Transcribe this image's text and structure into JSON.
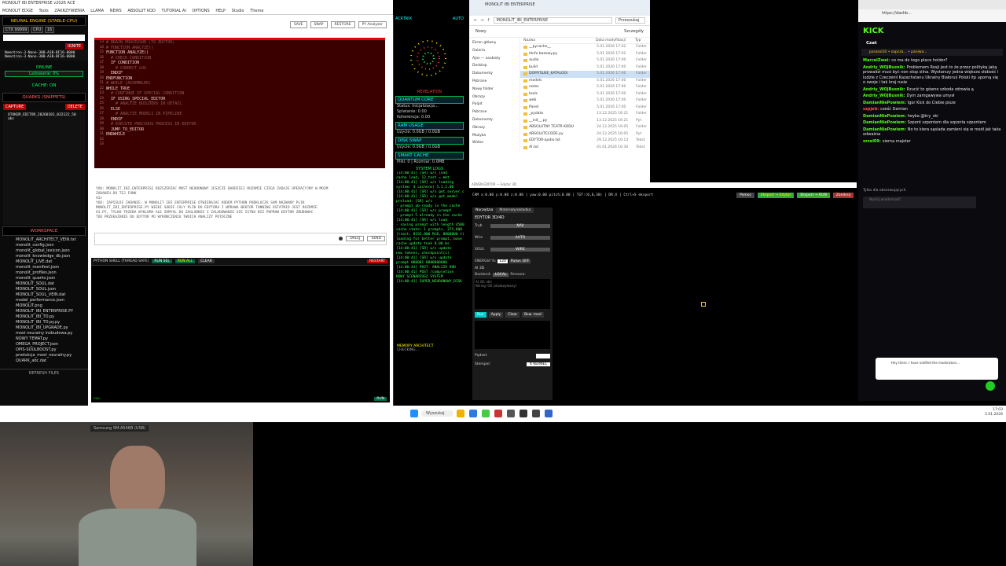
{
  "app": {
    "title": "MONOLIT IBI ENTERPRISE v2026 ACE",
    "menu": [
      "MONOLIT EDGE",
      "Tools",
      "ZAKRZYWIENIA",
      "LLAMA",
      "NEWS",
      "ABSOLUT KOD",
      "TUTORIAL AI",
      "OPTIONS",
      "HELP",
      "Studio",
      "Theme"
    ]
  },
  "left_panel": {
    "engine_title": "NEURAL ENGINE (STABLE-CPU)",
    "ctx": "CTX 99999",
    "cpu": "CPU",
    "mode": "16",
    "model_items": [
      "Nemotron-3-Nano-30B-A3B-BF16-0000",
      "Nemotron-3-Nano-30B-A3B-BF16-0000"
    ],
    "ignite": "IGNITE",
    "online": "ONLINE",
    "loading": "Ladowanie: 0%",
    "cache_on": "CACHE: ON",
    "quarks_title": "QUARKS (SNIPPETS)",
    "capture": "CAPTURE",
    "delete": "DELETE",
    "snippet": "OTOKEM_EDITOR_20260101_032122_50",
    "snippet_sub": "abc",
    "workspace_title": "WORKSPACE",
    "files": [
      "MONOLIT_ARCHITECT_VEIN.txt",
      "monolit_config.json",
      "monolit_global_lexicon.json",
      "monolit_knowledge_db.json",
      "MONOLIT_LIVE.dat",
      "monolit_manifest.json",
      "monolit_profiles.json",
      "monolit_quarks.json",
      "MONOLIT_SOUL.dat",
      "MONOLIT_SOUL.json",
      "MONOLIT_SOUL_VEIN.dat",
      "model_performance.json",
      "MONOLIT.png",
      "MONOLIT_IBI_ENTERPRISE.PY",
      "MONOLIT_IBI_TO.py",
      "MONOLIT_IBI_TO.py.py",
      "MONOLIT_IBI_UPGRADE.py",
      "most neuralny inzbudowa.py",
      "NOWY TEMAT.py",
      "OMEGA_PROJECT.json",
      "OPIS-SOULBOOST.py",
      "produkcja_most_neuralny.py",
      "QUARK_abc.dat"
    ],
    "refresh": "REFRESH FILES"
  },
  "editor": {
    "buttons": [
      "SAVE",
      "SNAP",
      "RESTORE",
      "PY Analyzer"
    ],
    "line_numbers": [
      "13",
      "14",
      "15",
      "16",
      "17",
      "18",
      "19",
      "20",
      "21",
      "22",
      "23",
      "24",
      "25",
      "26",
      "27",
      "28",
      "29",
      "30",
      "31",
      "32",
      "33"
    ],
    "code": [
      "# BRAIN PROCESSOR (TO EDYTOR)",
      "",
      "# FUNCTION ANALYZE()",
      "FUNCTION ANALYZE()",
      "  # CHECK CONDITION",
      "  IF CONDITION",
      "    # CORRECT LOG",
      "  ENDIF",
      "ENDFUNCTION",
      "",
      "# WHILE (ASSEMBLER)",
      "WHILE TRUE",
      "  # CONTINUE IF SPECIAL CONDITION",
      "  IF USING_SPECIAL_EDITOR",
      "    # ANALYZE BUILDERS IN DETAIL",
      "  ELSE",
      "    # ANALYZE MODELS IN PIPELINE",
      "  ENDIF",
      "  # EXECUTE PRECIOUS PROCESS IN EDITOR",
      "  JUMP_TO_EDITOR",
      "ENDWHILE"
    ]
  },
  "chat": {
    "lines": [
      "YOU: MONOLIT_IBI_ENTERPRISE ROZSZERZAC MOST NEURONOWY JESZCZE BARDZIEJ ROZUMIE CZEGO ZADAJE OPERACYJNY W MOIM",
      "ZADANIU DO TEJ FUNK",
      "AI>",
      "YOU: ZAPISUJE ZADANIE: W MONOLIT IBI ENTERPRISE OTWIERAJAC KODEM PYTHON PODKLUCZA SAM NAZWANY PLIK",
      "MONOLIT_IBI_ENTERPRISE.PY WIEKI SOBIE CALY PLIK DO EDYTORA I WPRAWA WEKTOR TUNNING OSTATNIO JEST ROZUMIE",
      "AI.PY, TYLKO TRZEBA WYKLUMA ALE ZAMYSL DO ZAGLADNIE I ZALADOWANIE SIE ISTNA BIZ POPRAW EDYTOR ZBUDOWAC",
      "TOO PRZEKAZANIE DO EDYTOR PO WYKONCZENIU TWOICH ANALIZY POTOCZNE"
    ],
    "buttons": [
      "DALEJ",
      "SEND"
    ]
  },
  "shell": {
    "title": "PYTHON SHELL (THREAD SAFE)",
    "buttons": [
      "RUN SEL",
      "RUN ALL",
      "CLEAR"
    ],
    "restart": "RESTART",
    "prompt": ">>>",
    "run": "RUN"
  },
  "mid_panel": {
    "acktrix": "ACKTRIX",
    "auto": "AUTO",
    "revelation": "REVELATION",
    "quantum": "QUANTUM CORE",
    "quantum_lines": [
      "Status: Inicjalizacja...",
      "Splatanie: 0.00",
      "Koherencja: 0.00"
    ],
    "ram": "RAM USAGE",
    "ram_val": "Uzycie: 0.0GB / 0.0GB",
    "disk": "DISK SWAP",
    "disk_val": "Uzycie: 0.0GB / 0.0GB",
    "cache": "SMART CACHE",
    "cache_val": "Pliki: 0 | Rozmiar: 0.0MB",
    "system_log": "SYSTEM LOGS",
    "log": [
      "[14:00:41] [SR] w/s   load",
      "  cache load, 12_test = mkt",
      "[14:00:41] [SR] w/s  loading",
      "  system: 4 cache(m) 5.1.1.00",
      "[14:00:41] [SR] w/s  get_server_c",
      "[14:00:41] [SR] w/s  get_model",
      "  preload: [SR] w/s",
      "  - prompt ab-ready in the cache",
      "[14:00:41] [SR] w/s  prompt",
      "  - prompt 5 already in the cache",
      "[14:00:41] [SR] w/s  load",
      "  - saving prompt with length 4500",
      "  cache state: 1 prompts, 375.000",
      "  (limit: 8192.000 MiB, 8000000 t)",
      "  loading for better prompt, base",
      "  cache update took 0.00 ms",
      "[14:00:41] [SR] w/s  update",
      "  new tokens, checkpoint(s)",
      "[14:00:41] [SR] w/s  update",
      "  prompt 000001-0000000000",
      "[14:00:41] POST: ANALIZA KOD",
      "[14:00:41] POST /completion",
      "  NOWY SCENARIUSZ SYSTEM",
      "[14:00:41] SUPER_NEURONOWY_DISK"
    ],
    "memory": "MEMORY ARCHITECT",
    "checking": "CHECKING..."
  },
  "explorer": {
    "tab": "MONOLIT IBI ENTERPRISE",
    "path": "MONOLIT_IBI_ENTERPRISE",
    "search": "Przeszukaj",
    "new_label": "Nowy",
    "sort_label": "Szczegóły",
    "nav": [
      "Ekran główny",
      "Galeria",
      "Ajos — osobisty",
      "Desktop",
      "Dokumenty",
      "Pobrane",
      "Nowy folder",
      "Obrazy",
      "Pulpit",
      "Pobrane",
      "Dokumenty",
      "Obrazy",
      "Muzyka",
      "Wideo"
    ],
    "columns": [
      "Nazwa",
      "Data modyfikacji",
      "Typ"
    ],
    "files": [
      "__pycache__",
      "hlnfo bazowy.py",
      "audio",
      "build",
      "DOMYŚLNE_KATALOGI",
      "models",
      "notes",
      "tools",
      "web",
      "Panel",
      "_pydata",
      "__init__.py",
      "ABSOLUTNY TEATR KODU",
      "ABSOLUTECODE.py",
      "EDYTOR-qudio.txt",
      "AI.txt"
    ],
    "dates": [
      "5.01.2026 17:02",
      "5.01.2026 17:02",
      "5.01.2026 17:00",
      "5.01.2026 17:00",
      "5.01.2026 17:00",
      "5.01.2026 17:00",
      "5.01.2026 17:00",
      "5.01.2026 17:00",
      "5.01.2026 17:00",
      "5.01.2026 17:00",
      "13.12.2025 16:21",
      "13.12.2025 16:21",
      "24.12.2025 16:05",
      "24.12.2025 16:05",
      "29.12.2025 16:13",
      "01.01.2026 16:30"
    ],
    "types": [
      "Folder",
      "Folder",
      "Folder",
      "Folder",
      "Folder",
      "Folder",
      "Folder",
      "Folder",
      "Folder",
      "Folder",
      "Folder",
      "Pyt",
      "Folder",
      "Pyt",
      "Tekst",
      "Tekst"
    ]
  },
  "editor3d": {
    "title": "ADVEN EDITOR — Edytor 3D",
    "status": "CAM x:0.00 y:0.00 z:0.00 | yaw:0.00 pitch:0.00 | TGT:(0,0,30) | DR:X | Ctrl+S eksport",
    "buttons": [
      "Pomoc",
      "Eksport → Edytor",
      "Eksport → RUN",
      "Zamknij"
    ],
    "tabs": [
      "Narzędzia",
      "Materiały/okładka"
    ],
    "panel_title": "EDYTOR 3D/4D",
    "rows": [
      [
        "Tryb",
        "NAV"
      ],
      [
        "Wiro",
        "AUTO"
      ],
      [
        "SOUL",
        "WIRE"
      ]
    ],
    "energy": "ENERGIA %:",
    "energy_val": "120",
    "pulse": "Pulse: OFF",
    "ai_label": "AI 3D",
    "backend": "Backend:",
    "backend_val": "LOCAL",
    "persona": "Persona:",
    "ai_status": [
      "AI 3D: idle",
      "Wiring: OK (skalowywany)"
    ],
    "actions": [
      "Run",
      "Apply",
      "Clear",
      "Bsw. mod"
    ],
    "pedzel": "Pędzel:",
    "stempel": "Stempel:",
    "stempel_val": "X KERNEL"
  },
  "kick": {
    "url": "https://dashb...",
    "logo": "KICK",
    "chat_title": "Czat",
    "pinned": "parasol10 • sapcza... • paniwa...",
    "messages": [
      {
        "user": "MarcelZwei:",
        "text": "co ma do tego place holder?",
        "color": "green"
      },
      {
        "user": "Andriy_WOJBusnik:",
        "text": "Problemem Rosji jest to że przez politykę jaką prowadzi musi być non stop silna. Wystarczy jedna większa słabość i ludzie z Czeczenii Kazachstanu Ukrainy Białoruś Polski itp uporną się o swoje i tak kraj rusie",
        "color": "green"
      },
      {
        "user": "Andriy_WOJBusnik:",
        "text": "Rzucić to gówno szkoda zdrowia ą",
        "color": "green"
      },
      {
        "user": "Andriy_WOJBusnik:",
        "text": "Dym zamgawywa umysł",
        "color": "green"
      },
      {
        "user": "DamianNiePowiem:",
        "text": "Igor Kick do Ciebie pisze",
        "color": "green"
      },
      {
        "user": "szpjeb:",
        "text": "cześć Damian",
        "color": "red"
      },
      {
        "user": "DamianNiePowiem:",
        "text": "heyka @kry_ski",
        "color": "green"
      },
      {
        "user": "DamianNiePowiem:",
        "text": "Szpont szpontem dla szponta szpontem",
        "color": "green"
      },
      {
        "user": "DamianNiePowiem:",
        "text": "No to kiera sąsiada zamieni się w rosół jak taka odważna",
        "color": "green"
      },
      {
        "user": "orzel09:",
        "text": "sierna majster",
        "color": "green"
      }
    ],
    "followers_note": "Tylko dla obserwujących",
    "input_placeholder": "Wyślij wiadomość",
    "toast": "Hey there. I have notified the moderators..."
  },
  "taskbar": {
    "search": "Wyszukaj",
    "time": "17:03",
    "date": "5.01.2026"
  },
  "webcam": {
    "label": "Samsung SM-A546B (USB)"
  }
}
